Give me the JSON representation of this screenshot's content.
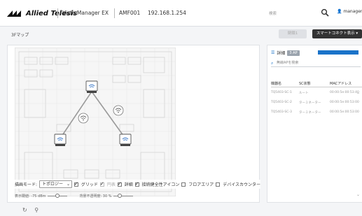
{
  "header": {
    "brand": "Allied Telesis",
    "product": "Vista Manager EX",
    "device": "AMF001",
    "ip": "192.168.1.254",
    "search_placeholder": "検索",
    "user": "manager"
  },
  "subheader": {
    "page_title": "3Fマップ",
    "disabled_button": "閉鎖1",
    "smart_connect_button": "スマートコネクト表示 ▾"
  },
  "map": {
    "controls": {
      "mode_label": "描画モード:",
      "mode_value": "トポロジー",
      "grid": "グリッド",
      "circle": "円表",
      "details": "詳細",
      "health_icon": "接続健全性アイコン",
      "floor_area": "フロアエリア",
      "device_counter": "デバイスカウンター",
      "grid_checked": true,
      "circle_checked": true,
      "details_checked": true,
      "health_checked": true,
      "floor_area_checked": false,
      "device_counter_checked": false
    },
    "threshold_label": "表示閾値: -75 dBm",
    "opacity_label": "背景不透明度: 30 %",
    "threshold_position": 0.5,
    "opacity_position": 0.3,
    "line_color": "#9a9a9a",
    "node_color": "#3a78c8"
  },
  "right_panel": {
    "title": "詳細",
    "badge": "3 AP",
    "search_placeholder": "無線APを検索",
    "columns": [
      "機器名",
      "SC状態",
      "MACアドレス"
    ],
    "rows": [
      [
        "TQ5403-SC-1",
        "ルート",
        "00:00:5e:00:53:40"
      ],
      [
        "TQ5403-SC-2",
        "ターミネーター",
        "00:00:5e:00:53:00"
      ],
      [
        "TQ5403-SC-3",
        "ターミネーター",
        "00:00:5e:00:53:00"
      ]
    ]
  }
}
